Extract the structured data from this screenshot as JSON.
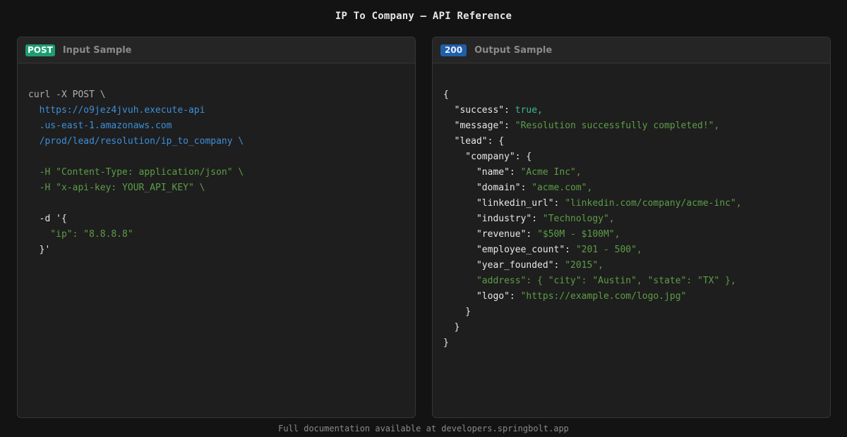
{
  "page_title": "IP To Company — API Reference",
  "input_panel": {
    "method_badge": "POST",
    "label": "Input Sample",
    "lines": {
      "l1": "curl -X POST \\",
      "l2": "  https://o9jez4jvuh.execute-api",
      "l3": "  .us-east-1.amazonaws.com",
      "l4": "  /prod/lead/resolution/ip_to_company \\",
      "l6": "  -H \"Content-Type: application/json\" \\",
      "l7": "  -H \"x-api-key: YOUR_API_KEY\" \\",
      "l9": "  -d '{",
      "l10": "    \"ip\": \"8.8.8.8\"",
      "l11": "  }'"
    }
  },
  "output_panel": {
    "status_badge": "200",
    "label": "Output Sample",
    "json": {
      "open": "{",
      "success_key": "  \"success\": ",
      "success_val": "true,",
      "message_key": "  \"message\": ",
      "message_val": "\"Resolution successfully completed!\",",
      "lead_open": "  \"lead\": {",
      "company_open": "    \"company\": {",
      "name_key": "      \"name\": ",
      "name_val": "\"Acme Inc\",",
      "domain_key": "      \"domain\": ",
      "domain_val": "\"acme.com\",",
      "linkedin_key": "      \"linkedin_url\": ",
      "linkedin_val": "\"linkedin.com/company/acme-inc\",",
      "industry_key": "      \"industry\": ",
      "industry_val": "\"Technology\",",
      "revenue_key": "      \"revenue\": ",
      "revenue_val": "\"$50M - $100M\",",
      "employee_key": "      \"employee_count\": ",
      "employee_val": "\"201 - 500\",",
      "year_key": "      \"year_founded\": ",
      "year_val": "\"2015\",",
      "address_line": "      \"address\": { \"city\": \"Austin\", \"state\": \"TX\" },",
      "logo_key": "      \"logo\": ",
      "logo_val": "\"https://example.com/logo.jpg\"",
      "company_close": "    }",
      "lead_close": "  }",
      "close": "}"
    }
  },
  "footer": "Full documentation available at developers.springbolt.app",
  "colors": {
    "background": "#131313",
    "panel": "#1e1e1e",
    "post_badge": "#1e9c74",
    "status_badge": "#1f5fa8",
    "url_blue": "#3d8fd9",
    "string_green": "#5d9d46",
    "bool_green": "#3dbb8c"
  }
}
